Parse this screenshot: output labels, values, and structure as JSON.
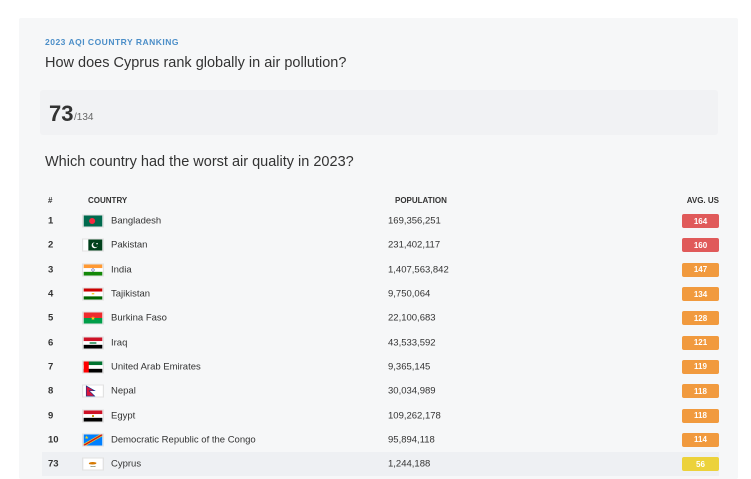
{
  "header": {
    "kicker": "2023 AQI COUNTRY RANKING",
    "question": "How does Cyprus rank globally in air pollution?"
  },
  "rank": {
    "value": "73",
    "total": "/134"
  },
  "table": {
    "question": "Which country had the worst air quality in 2023?",
    "columns": {
      "rank": "#",
      "country": "COUNTRY",
      "population": "POPULATION",
      "aqi": "AVG. US"
    },
    "rows": [
      {
        "rank": "1",
        "country": "Bangladesh",
        "population": "169,356,251",
        "aqi": "164",
        "aqi_color": "#e05a5a",
        "flag": "bangladesh-flag-icon"
      },
      {
        "rank": "2",
        "country": "Pakistan",
        "population": "231,402,117",
        "aqi": "160",
        "aqi_color": "#e05a5a",
        "flag": "pakistan-flag-icon"
      },
      {
        "rank": "3",
        "country": "India",
        "population": "1,407,563,842",
        "aqi": "147",
        "aqi_color": "#f19a3e",
        "flag": "india-flag-icon"
      },
      {
        "rank": "4",
        "country": "Tajikistan",
        "population": "9,750,064",
        "aqi": "134",
        "aqi_color": "#f19a3e",
        "flag": "tajikistan-flag-icon"
      },
      {
        "rank": "5",
        "country": "Burkina Faso",
        "population": "22,100,683",
        "aqi": "128",
        "aqi_color": "#f19a3e",
        "flag": "burkina-faso-flag-icon"
      },
      {
        "rank": "6",
        "country": "Iraq",
        "population": "43,533,592",
        "aqi": "121",
        "aqi_color": "#f19a3e",
        "flag": "iraq-flag-icon"
      },
      {
        "rank": "7",
        "country": "United Arab Emirates",
        "population": "9,365,145",
        "aqi": "119",
        "aqi_color": "#f19a3e",
        "flag": "uae-flag-icon"
      },
      {
        "rank": "8",
        "country": "Nepal",
        "population": "30,034,989",
        "aqi": "118",
        "aqi_color": "#f19a3e",
        "flag": "nepal-flag-icon"
      },
      {
        "rank": "9",
        "country": "Egypt",
        "population": "109,262,178",
        "aqi": "118",
        "aqi_color": "#f19a3e",
        "flag": "egypt-flag-icon"
      },
      {
        "rank": "10",
        "country": "Democratic Republic of the Congo",
        "population": "95,894,118",
        "aqi": "114",
        "aqi_color": "#f19a3e",
        "flag": "drc-flag-icon"
      },
      {
        "rank": "73",
        "country": "Cyprus",
        "population": "1,244,188",
        "aqi": "56",
        "aqi_color": "#ecd23b",
        "flag": "cyprus-flag-icon",
        "highlight": true
      }
    ]
  }
}
